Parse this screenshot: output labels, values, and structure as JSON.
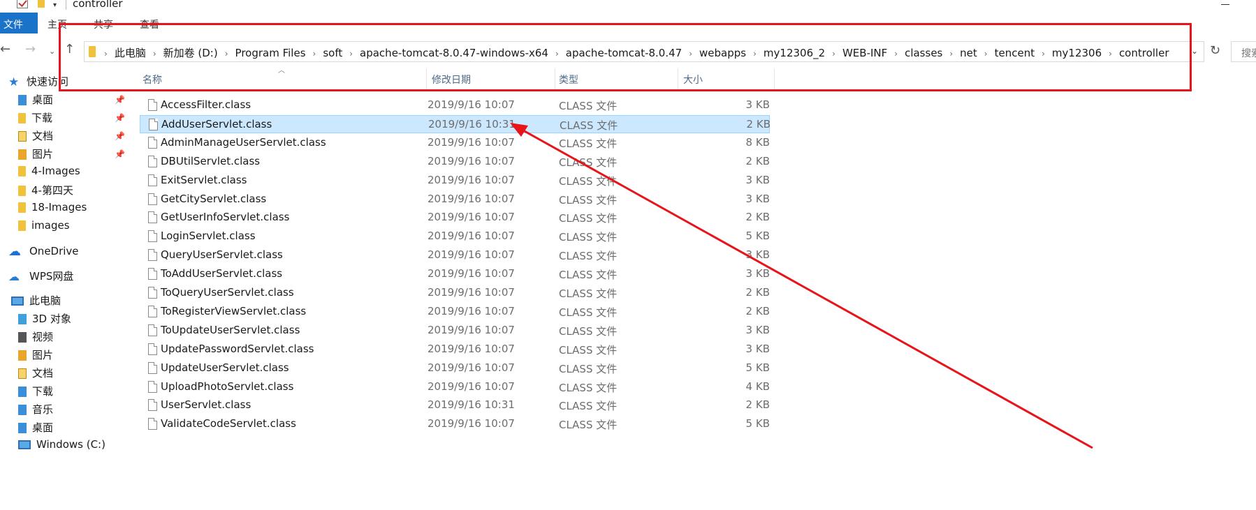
{
  "window": {
    "title": "controller"
  },
  "ribbon": {
    "tabs": [
      "文件",
      "主页",
      "共享",
      "查看"
    ]
  },
  "address": {
    "breadcrumbs": [
      "此电脑",
      "新加卷 (D:)",
      "Program Files",
      "soft",
      "apache-tomcat-8.0.47-windows-x64",
      "apache-tomcat-8.0.47",
      "webapps",
      "my12306_2",
      "WEB-INF",
      "classes",
      "net",
      "tencent",
      "my12306",
      "controller"
    ],
    "search_placeholder": "搜索"
  },
  "sidebar": {
    "quick_access": "快速访问",
    "items": [
      {
        "label": "桌面",
        "icon": "desktop-folder-icon",
        "pinned": true
      },
      {
        "label": "下载",
        "icon": "download-folder-icon",
        "pinned": true
      },
      {
        "label": "文档",
        "icon": "documents-folder-icon",
        "pinned": true
      },
      {
        "label": "图片",
        "icon": "pictures-folder-icon",
        "pinned": true
      },
      {
        "label": "4-Images",
        "icon": "folder-icon",
        "pinned": false
      },
      {
        "label": "4-第四天",
        "icon": "folder-icon",
        "pinned": false
      },
      {
        "label": "18-Images",
        "icon": "folder-icon",
        "pinned": false
      },
      {
        "label": "images",
        "icon": "folder-icon",
        "pinned": false
      }
    ],
    "onedrive": "OneDrive",
    "wps": "WPS网盘",
    "this_pc": "此电脑",
    "pc_items": [
      {
        "label": "3D 对象",
        "icon": "3d-objects-icon"
      },
      {
        "label": "视频",
        "icon": "videos-icon"
      },
      {
        "label": "图片",
        "icon": "pictures-icon"
      },
      {
        "label": "文档",
        "icon": "documents-icon"
      },
      {
        "label": "下载",
        "icon": "downloads-icon"
      },
      {
        "label": "音乐",
        "icon": "music-icon"
      },
      {
        "label": "桌面",
        "icon": "desktop-icon"
      },
      {
        "label": "Windows (C:)",
        "icon": "drive-icon"
      }
    ]
  },
  "columns": {
    "name": "名称",
    "date": "修改日期",
    "type": "类型",
    "size": "大小"
  },
  "files": [
    {
      "name": "AccessFilter.class",
      "date": "2019/9/16 10:07",
      "type": "CLASS 文件",
      "size": "3 KB",
      "selected": false
    },
    {
      "name": "AddUserServlet.class",
      "date": "2019/9/16 10:31",
      "type": "CLASS 文件",
      "size": "2 KB",
      "selected": true
    },
    {
      "name": "AdminManageUserServlet.class",
      "date": "2019/9/16 10:07",
      "type": "CLASS 文件",
      "size": "8 KB",
      "selected": false
    },
    {
      "name": "DBUtilServlet.class",
      "date": "2019/9/16 10:07",
      "type": "CLASS 文件",
      "size": "2 KB",
      "selected": false
    },
    {
      "name": "ExitServlet.class",
      "date": "2019/9/16 10:07",
      "type": "CLASS 文件",
      "size": "3 KB",
      "selected": false
    },
    {
      "name": "GetCityServlet.class",
      "date": "2019/9/16 10:07",
      "type": "CLASS 文件",
      "size": "3 KB",
      "selected": false
    },
    {
      "name": "GetUserInfoServlet.class",
      "date": "2019/9/16 10:07",
      "type": "CLASS 文件",
      "size": "2 KB",
      "selected": false
    },
    {
      "name": "LoginServlet.class",
      "date": "2019/9/16 10:07",
      "type": "CLASS 文件",
      "size": "5 KB",
      "selected": false
    },
    {
      "name": "QueryUserServlet.class",
      "date": "2019/9/16 10:07",
      "type": "CLASS 文件",
      "size": "3 KB",
      "selected": false
    },
    {
      "name": "ToAddUserServlet.class",
      "date": "2019/9/16 10:07",
      "type": "CLASS 文件",
      "size": "3 KB",
      "selected": false
    },
    {
      "name": "ToQueryUserServlet.class",
      "date": "2019/9/16 10:07",
      "type": "CLASS 文件",
      "size": "2 KB",
      "selected": false
    },
    {
      "name": "ToRegisterViewServlet.class",
      "date": "2019/9/16 10:07",
      "type": "CLASS 文件",
      "size": "2 KB",
      "selected": false
    },
    {
      "name": "ToUpdateUserServlet.class",
      "date": "2019/9/16 10:07",
      "type": "CLASS 文件",
      "size": "3 KB",
      "selected": false
    },
    {
      "name": "UpdatePasswordServlet.class",
      "date": "2019/9/16 10:07",
      "type": "CLASS 文件",
      "size": "3 KB",
      "selected": false
    },
    {
      "name": "UpdateUserServlet.class",
      "date": "2019/9/16 10:07",
      "type": "CLASS 文件",
      "size": "5 KB",
      "selected": false
    },
    {
      "name": "UploadPhotoServlet.class",
      "date": "2019/9/16 10:07",
      "type": "CLASS 文件",
      "size": "4 KB",
      "selected": false
    },
    {
      "name": "UserServlet.class",
      "date": "2019/9/16 10:31",
      "type": "CLASS 文件",
      "size": "2 KB",
      "selected": false
    },
    {
      "name": "ValidateCodeServlet.class",
      "date": "2019/9/16 10:07",
      "type": "CLASS 文件",
      "size": "5 KB",
      "selected": false
    }
  ],
  "colors": {
    "accent": "#1a73c9",
    "selection": "#cce8ff",
    "annotation_red": "#e8141a"
  }
}
